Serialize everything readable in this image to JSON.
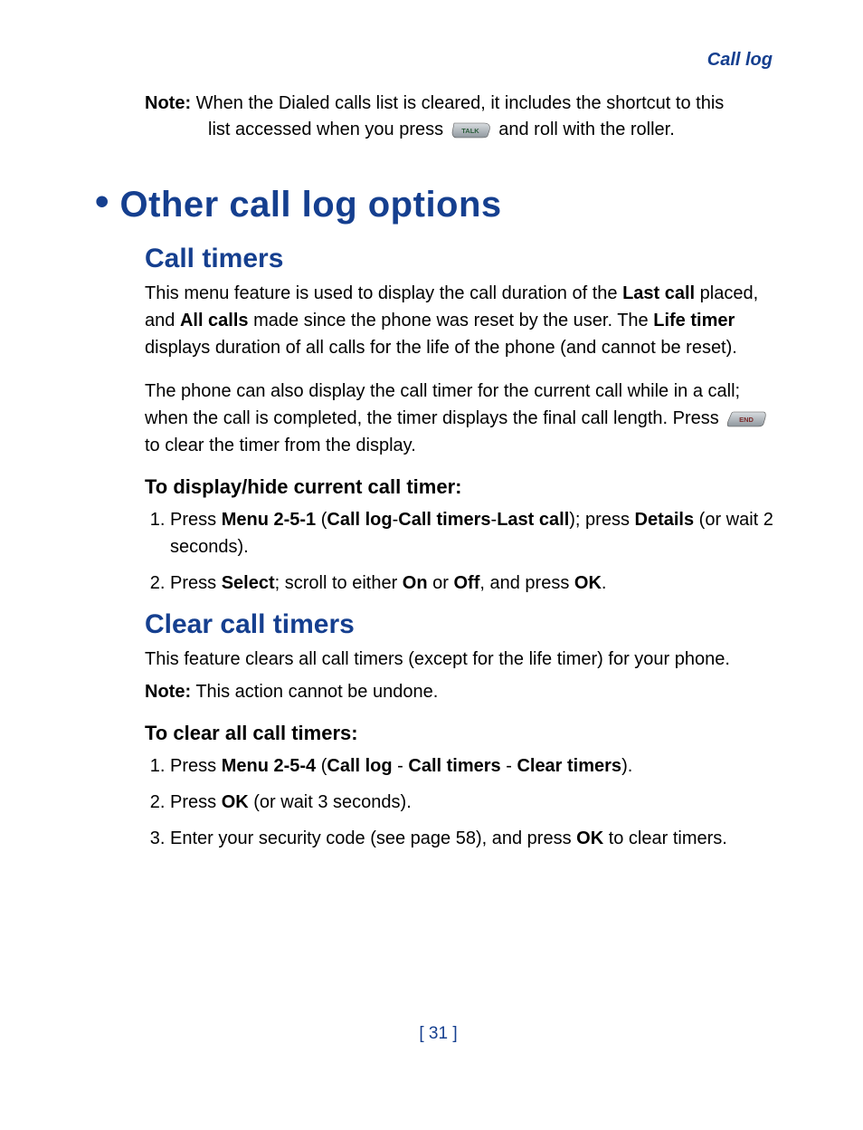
{
  "header": {
    "right": "Call log"
  },
  "topnote": {
    "label": "Note:",
    "t1": "When the Dialed calls list is cleared, it includes the shortcut to this",
    "t2a": "list accessed when you press ",
    "t2b": " and roll with the roller."
  },
  "h1": "Other call log options",
  "sec1": {
    "heading": "Call timers",
    "p1a": "This menu feature is used to display the call duration of the ",
    "p1_lastcall": "Last call",
    "p1b": " placed, and ",
    "p1_allcalls": "All calls",
    "p1c": " made since the phone was reset by the user. The ",
    "p1_lifetimer": "Life timer",
    "p1d": " displays duration of all calls for the life of the phone (and cannot be reset).",
    "p2a": "The phone can also display the call timer for the current call while in a call; when the call is completed, the timer displays the final call length. Press ",
    "p2b": " to clear the timer from the display.",
    "proc_head": "To display/hide current call timer:",
    "steps": {
      "s1a": "Press ",
      "s1b": "Menu 2-5-1",
      "s1c": " (",
      "s1d": "Call log",
      "s1e": "-",
      "s1f": "Call timers",
      "s1g": "-",
      "s1h": "Last call",
      "s1i": "); press ",
      "s1j": "Details",
      "s1k": " (or wait 2 seconds).",
      "s2a": "Press ",
      "s2b": "Select",
      "s2c": "; scroll to either ",
      "s2d": "On",
      "s2e": " or ",
      "s2f": "Off",
      "s2g": ", and press ",
      "s2h": "OK",
      "s2i": "."
    }
  },
  "sec2": {
    "heading": "Clear call timers",
    "p1": "This feature clears all call timers (except for the life timer) for your phone.",
    "note_label": "Note:",
    "note_text": "This action cannot be undone.",
    "proc_head": "To clear all call timers:",
    "steps": {
      "s1a": "Press ",
      "s1b": "Menu 2-5-4",
      "s1c": " (",
      "s1d": "Call log",
      "s1e": " - ",
      "s1f": "Call timers",
      "s1g": " - ",
      "s1h": "Clear timers",
      "s1i": ").",
      "s2a": "Press ",
      "s2b": "OK",
      "s2c": " (or wait 3 seconds).",
      "s3a": "Enter your security code (see page 58), and press ",
      "s3b": "OK",
      "s3c": " to clear timers."
    }
  },
  "keys": {
    "talk": "TALK",
    "end": "END"
  },
  "footer": {
    "pagenum": "[ 31 ]"
  }
}
